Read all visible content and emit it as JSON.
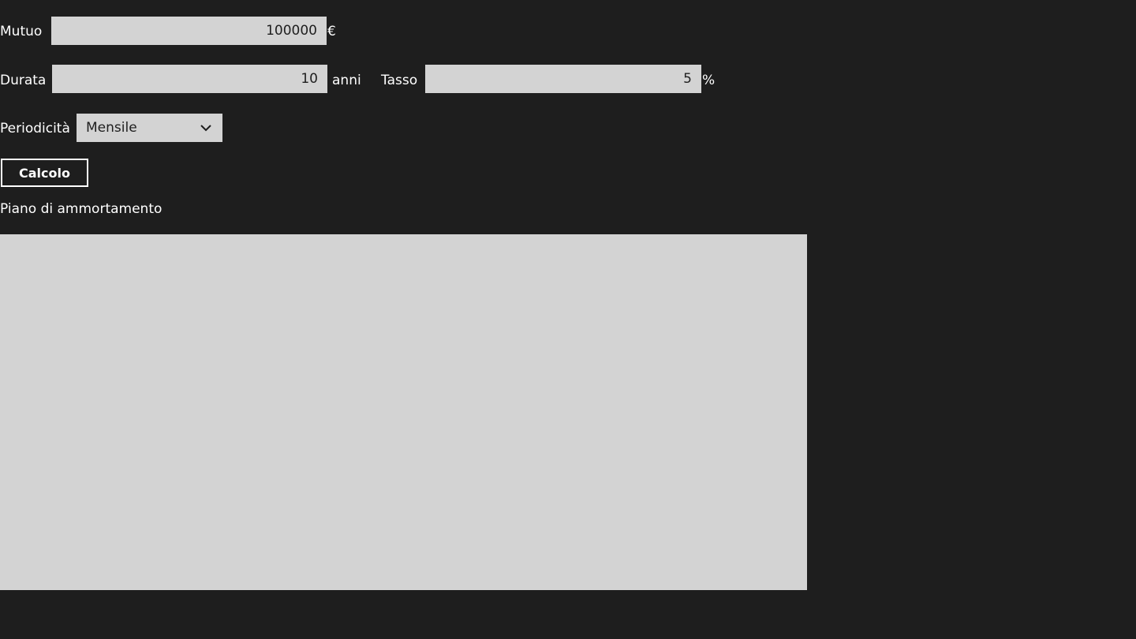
{
  "form": {
    "mutuo_label": "Mutuo",
    "mutuo_value": "100000",
    "mutuo_unit": "€",
    "durata_label": "Durata",
    "durata_value": "10",
    "durata_unit": "anni",
    "tasso_label": "Tasso",
    "tasso_value": "5",
    "tasso_unit": "%",
    "periodicita_label": "Periodicità",
    "periodicita_selected": "Mensile",
    "calcolo_label": "Calcolo",
    "piano_label": "Piano di ammortamento"
  },
  "icons": {
    "dropdown": "chevron-down-icon"
  },
  "colors": {
    "background": "#1e1e1e",
    "field": "#d3d3d3",
    "text": "#ffffff"
  }
}
